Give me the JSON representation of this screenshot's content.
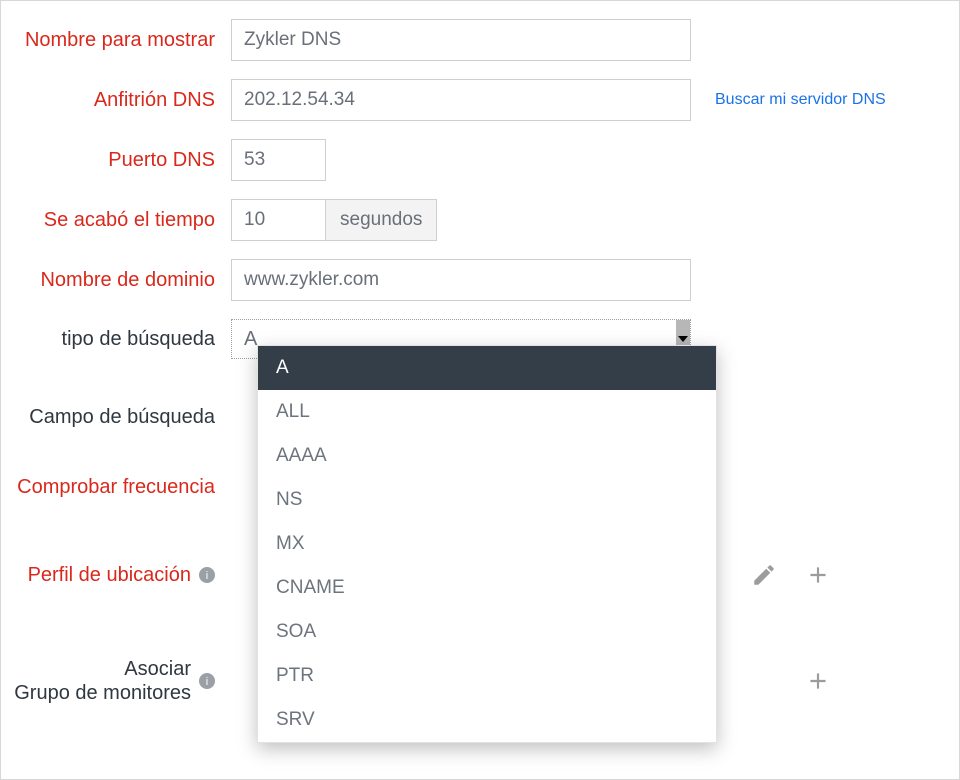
{
  "labels": {
    "display_name": "Nombre para mostrar",
    "dns_host": "Anfitrión DNS",
    "dns_port": "Puerto DNS",
    "timeout": "Se acabó el tiempo",
    "domain_name": "Nombre de dominio",
    "search_type": "tipo de búsqueda",
    "search_field": "Campo de búsqueda",
    "check_freq": "Comprobar frecuencia",
    "loc_profile": "Perfil de ubicación",
    "associate_l1": "Asociar",
    "associate_l2": "Grupo de monitores"
  },
  "fields": {
    "display_name": "Zykler DNS",
    "dns_host": "202.12.54.34",
    "dns_port": "53",
    "timeout": "10",
    "timeout_unit": "segundos",
    "domain_name": "www.zykler.com",
    "search_type_value": "A"
  },
  "links": {
    "lookup_dns": "Buscar mi servidor DNS"
  },
  "search_type_options": [
    "A",
    "ALL",
    "AAAA",
    "NS",
    "MX",
    "CNAME",
    "SOA",
    "PTR",
    "SRV"
  ],
  "search_type_selected_index": 0
}
